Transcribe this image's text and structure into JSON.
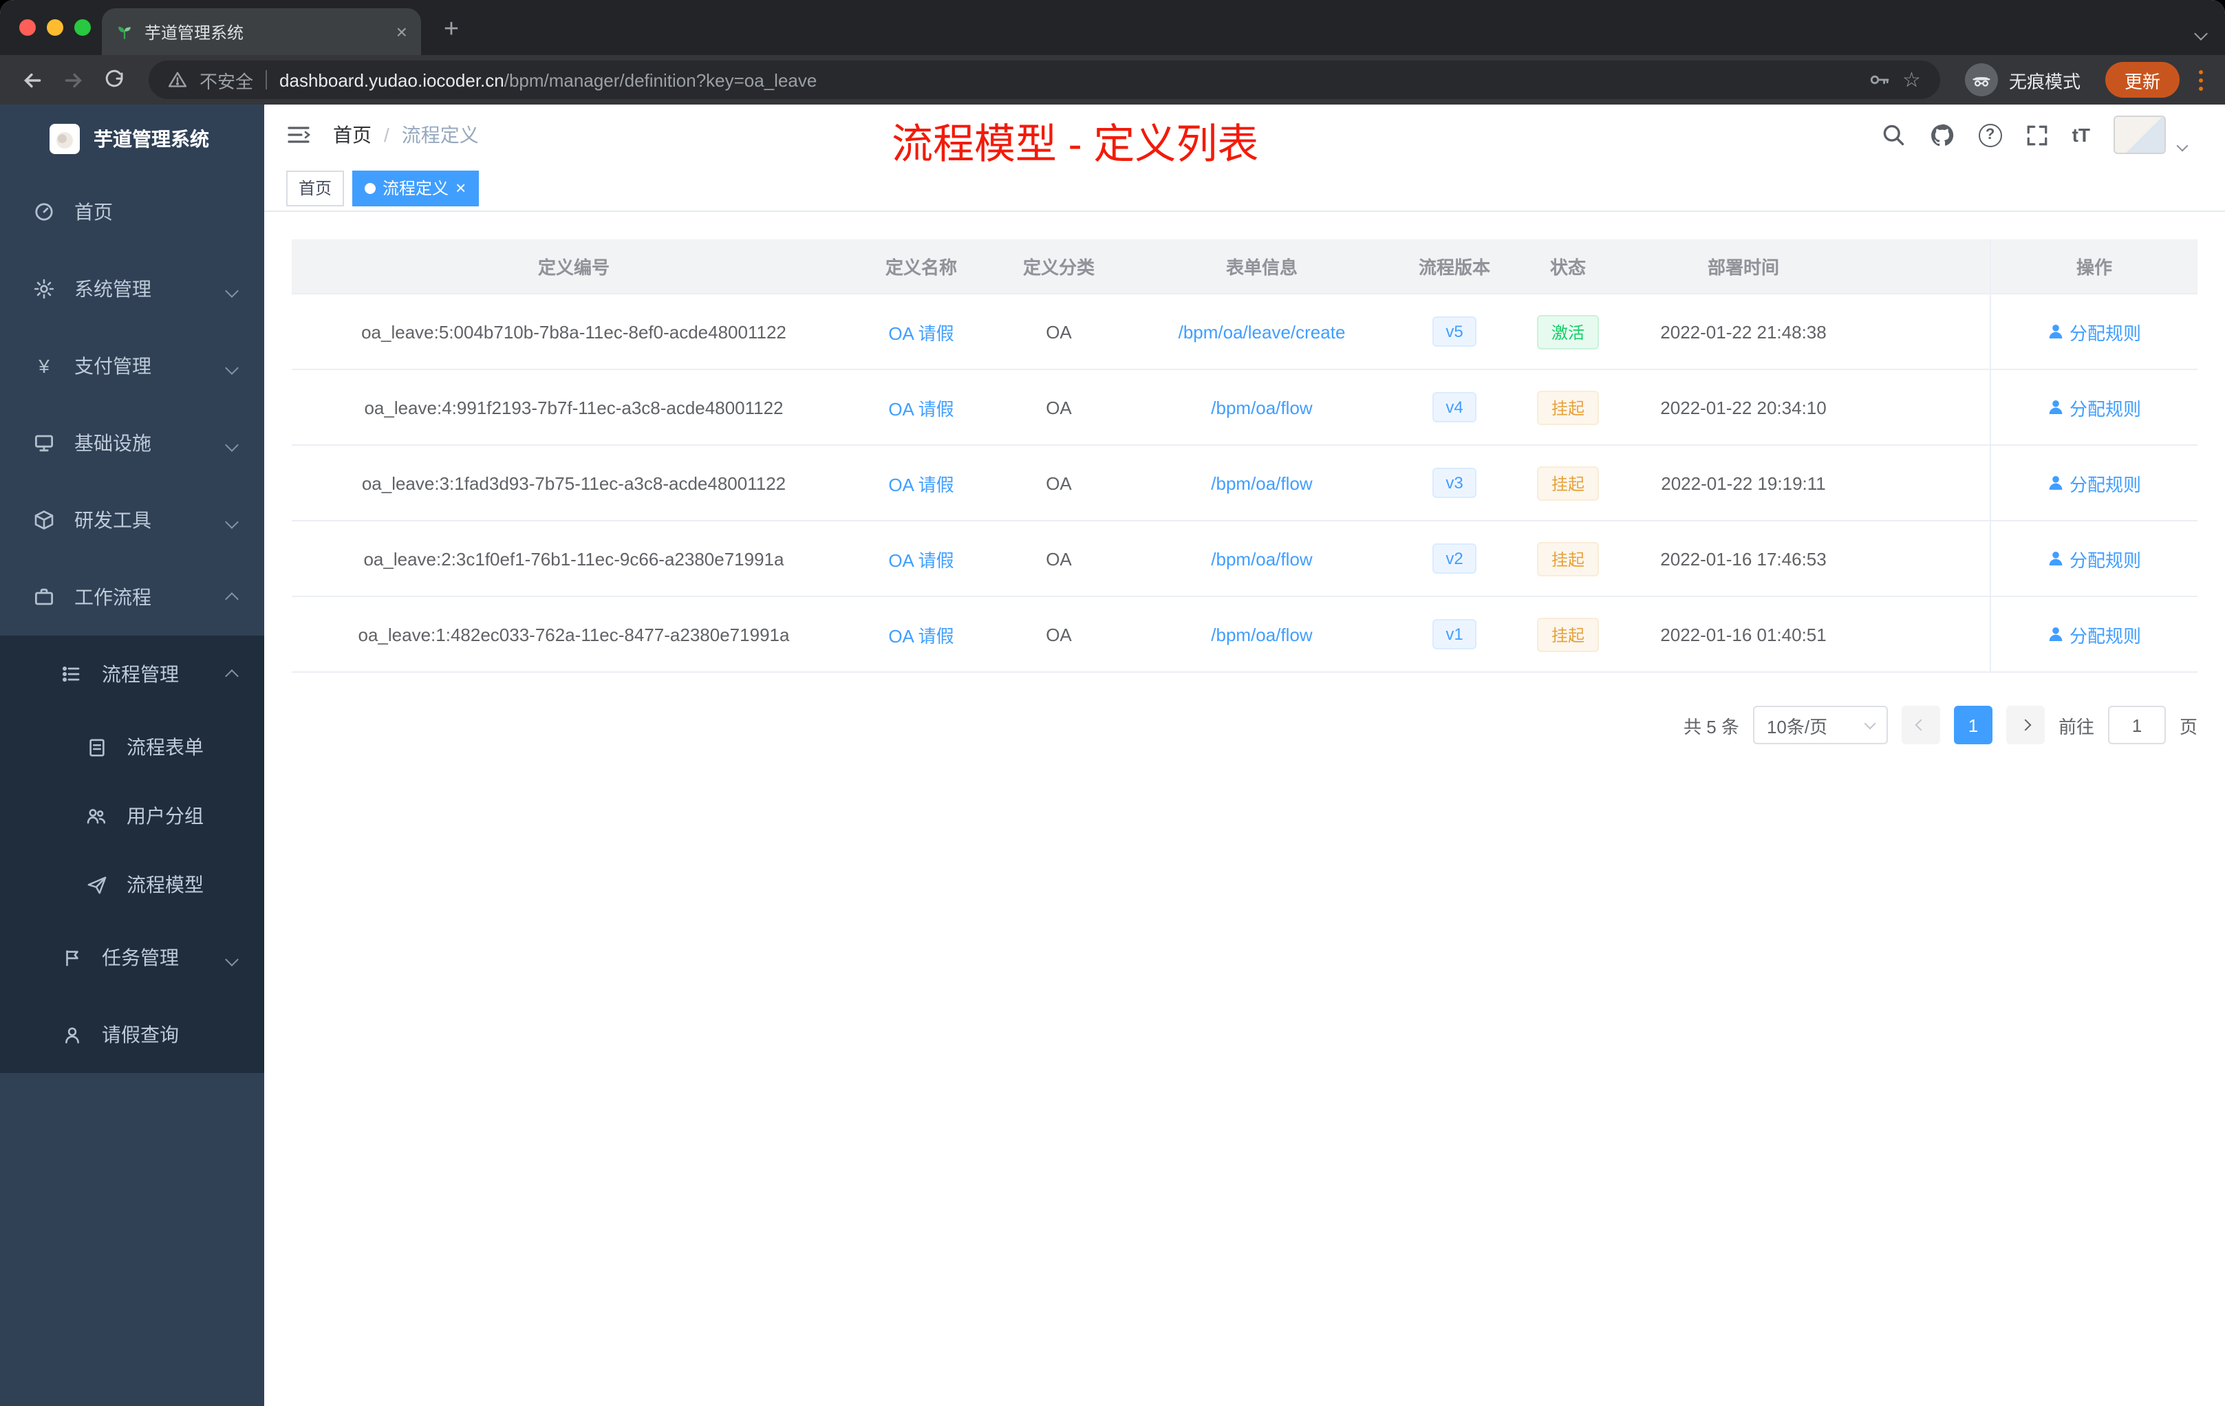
{
  "browser": {
    "tab_title": "芋道管理系统",
    "security_label": "不安全",
    "url_host": "dashboard.yudao.iocoder.cn",
    "url_path": "/bpm/manager/definition?key=oa_leave",
    "incognito_label": "无痕模式",
    "update_label": "更新"
  },
  "sidebar": {
    "logo_title": "芋道管理系统",
    "items": {
      "home": "首页",
      "system": "系统管理",
      "payment": "支付管理",
      "infra": "基础设施",
      "devtools": "研发工具",
      "workflow": "工作流程",
      "process_mgmt": "流程管理",
      "process_form": "流程表单",
      "user_group": "用户分组",
      "process_model": "流程模型",
      "task_mgmt": "任务管理",
      "leave_query": "请假查询"
    }
  },
  "topbar": {
    "breadcrumb_home": "首页",
    "breadcrumb_sep": "/",
    "breadcrumb_current": "流程定义",
    "annotation": "流程模型 - 定义列表",
    "fontsize_icon_label": "tT",
    "help_icon_label": "?"
  },
  "tags": {
    "home": "首页",
    "active": "流程定义",
    "close": "×"
  },
  "table": {
    "headers": [
      "定义编号",
      "定义名称",
      "定义分类",
      "表单信息",
      "流程版本",
      "状态",
      "部署时间",
      "操作"
    ],
    "rows": [
      {
        "id": "oa_leave:5:004b710b-7b8a-11ec-8ef0-acde48001122",
        "name": "OA 请假",
        "category": "OA",
        "form": "/bpm/oa/leave/create",
        "version": "v5",
        "status": "激活",
        "time": "2022-01-22 21:48:38",
        "action": "分配规则"
      },
      {
        "id": "oa_leave:4:991f2193-7b7f-11ec-a3c8-acde48001122",
        "name": "OA 请假",
        "category": "OA",
        "form": "/bpm/oa/flow",
        "version": "v4",
        "status": "挂起",
        "time": "2022-01-22 20:34:10",
        "action": "分配规则"
      },
      {
        "id": "oa_leave:3:1fad3d93-7b75-11ec-a3c8-acde48001122",
        "name": "OA 请假",
        "category": "OA",
        "form": "/bpm/oa/flow",
        "version": "v3",
        "status": "挂起",
        "time": "2022-01-22 19:19:11",
        "action": "分配规则"
      },
      {
        "id": "oa_leave:2:3c1f0ef1-76b1-11ec-9c66-a2380e71991a",
        "name": "OA 请假",
        "category": "OA",
        "form": "/bpm/oa/flow",
        "version": "v2",
        "status": "挂起",
        "time": "2022-01-16 17:46:53",
        "action": "分配规则"
      },
      {
        "id": "oa_leave:1:482ec033-762a-11ec-8477-a2380e71991a",
        "name": "OA 请假",
        "category": "OA",
        "form": "/bpm/oa/flow",
        "version": "v1",
        "status": "挂起",
        "time": "2022-01-16 01:40:51",
        "action": "分配规则"
      }
    ]
  },
  "pagination": {
    "total": "共 5 条",
    "page_size": "10条/页",
    "current_page": "1",
    "goto_label": "前往",
    "goto_value": "1",
    "page_unit": "页"
  },
  "colors": {
    "primary": "#409eff",
    "sidebar_bg": "#304156",
    "submenu_bg": "#1f2d3d",
    "annotation_red": "#f21b0a",
    "status_active": "#13ce66",
    "status_suspended": "#e6a23c"
  }
}
